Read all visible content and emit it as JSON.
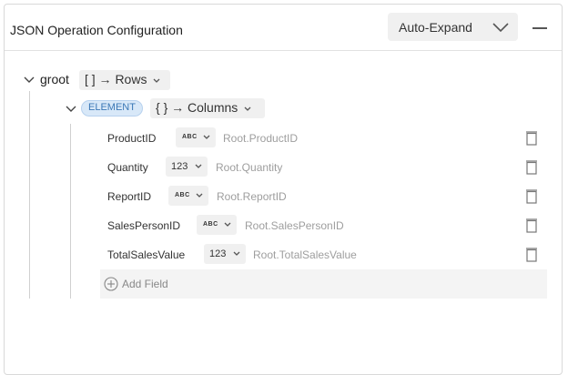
{
  "header": {
    "title": "JSON Operation Configuration",
    "expand_mode": "Auto-Expand",
    "icons": [
      "chevron-down-icon",
      "minimize-icon"
    ]
  },
  "root": {
    "name": "groot",
    "type_mapping": "[ ] → Rows",
    "element": {
      "badge": "ELEMENT",
      "type_mapping": "{ } → Columns"
    }
  },
  "fields": [
    {
      "name": "ProductID",
      "type": "ABC",
      "path": "Root.ProductID"
    },
    {
      "name": "Quantity",
      "type": "123",
      "path": "Root.Quantity"
    },
    {
      "name": "ReportID",
      "type": "ABC",
      "path": "Root.ReportID"
    },
    {
      "name": "SalesPersonID",
      "type": "ABC",
      "path": "Root.SalesPersonID"
    },
    {
      "name": "TotalSalesValue",
      "type": "123",
      "path": "Root.TotalSalesValue"
    }
  ],
  "add_field_label": "Add Field"
}
